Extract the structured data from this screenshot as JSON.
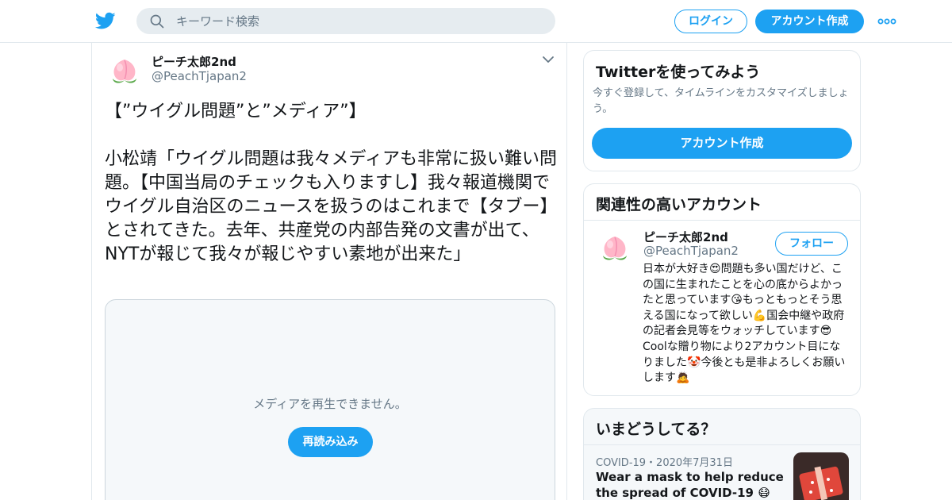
{
  "nav": {
    "logo_icon": "twitter-bird-icon",
    "search": {
      "placeholder": "キーワード検索",
      "icon": "search-icon"
    },
    "login_label": "ログイン",
    "signup_label": "アカウント作成",
    "more_icon": "more-dots-icon"
  },
  "tweet": {
    "author_name": "ピーチ太郎2nd",
    "author_handle": "@PeachTjapan2",
    "avatar_icon": "peach-avatar-icon",
    "menu_icon": "chevron-down-icon",
    "text": "【”ウイグル問題”と”メディア”】\n\n小松靖「ウイグル問題は我々メディアも非常に扱い難い問題。【中国当局のチェックも入りますし】我々報道機関でウイグル自治区のニュースを扱うのはこれまで【タブー】とされてきた。去年、共産党の内部告発の文書が出て、NYTが報じて我々が報じやすい素地が出来た」",
    "media": {
      "message": "メディアを再生できません。",
      "reload_label": "再読み込み"
    }
  },
  "sidebar": {
    "signup_card": {
      "title": "Twitterを使ってみよう",
      "description": "今すぐ登録して、タイムラインをカスタマイズしましょう。",
      "button_label": "アカウント作成"
    },
    "related_card": {
      "title": "関連性の高いアカウント",
      "account": {
        "name": "ピーチ太郎2nd",
        "handle": "@PeachTjapan2",
        "follow_label": "フォロー",
        "bio": "日本が大好き😍問題も多い国だけど、この国に生まれたことを心の底からよかったと思っています😘もっともっとそう思える国になって欲しい💪国会中継や政府の記者会見等をウォッチしています😎Coolな贈り物により2アカウント目になりました🤡今後とも是非よろしくお願いします🙇"
      }
    },
    "trends_card": {
      "title": "いまどうしてる？",
      "item": {
        "meta": "COVID-19・2020年7月31日",
        "headline": "Wear a mask to help reduce the spread of COVID-19 😷"
      }
    }
  },
  "colors": {
    "accent": "#1da1f2",
    "border": "#e1e8ed",
    "muted_text": "#657786",
    "search_bg": "#e6ecf0"
  }
}
